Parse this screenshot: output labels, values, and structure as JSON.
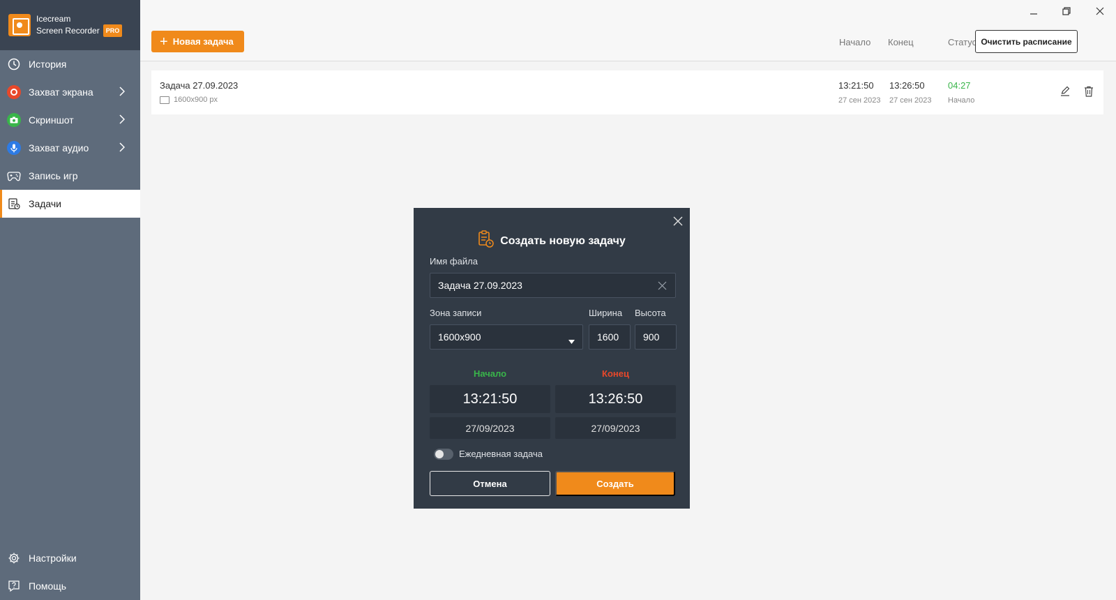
{
  "app": {
    "brand_line1": "Icecream",
    "brand_line2": "Screen Recorder",
    "badge": "PRO",
    "accent_color": "#f08a1b"
  },
  "sidebar": {
    "items": [
      {
        "label": "История",
        "icon": "clock-icon"
      },
      {
        "label": "Захват экрана",
        "icon": "record-icon",
        "has_submenu": true
      },
      {
        "label": "Скриншот",
        "icon": "camera-icon",
        "has_submenu": true
      },
      {
        "label": "Захват аудио",
        "icon": "microphone-icon",
        "has_submenu": true
      },
      {
        "label": "Запись игр",
        "icon": "gamepad-icon"
      },
      {
        "label": "Задачи",
        "icon": "task-icon",
        "active": true
      }
    ],
    "bottom": [
      {
        "label": "Настройки",
        "icon": "gear-icon"
      },
      {
        "label": "Помощь",
        "icon": "help-icon"
      }
    ]
  },
  "toolbar": {
    "new_task_label": "Новая задача",
    "col_start": "Начало",
    "col_end": "Конец",
    "col_status": "Статус",
    "clear_label": "Очистить расписание"
  },
  "tasks": [
    {
      "name": "Задача 27.09.2023",
      "resolution": "1600x900 px",
      "start_time": "13:21:50",
      "start_date": "27 сен 2023",
      "end_time": "13:26:50",
      "end_date": "27 сен 2023",
      "status_time": "04:27",
      "status_label": "Начало"
    }
  ],
  "dialog": {
    "title": "Создать новую задачу",
    "filename_label": "Имя файла",
    "filename_value": "Задача 27.09.2023",
    "zone_label": "Зона записи",
    "zone_value": "1600x900",
    "width_label": "Ширина",
    "width_value": "1600",
    "height_label": "Высота",
    "height_value": "900",
    "start_label": "Начало",
    "end_label": "Конец",
    "start_time": "13:21:50",
    "end_time": "13:26:50",
    "start_date": "27/09/2023",
    "end_date": "27/09/2023",
    "daily_label": "Ежедневная задача",
    "daily_enabled": false,
    "cancel_label": "Отмена",
    "create_label": "Создать",
    "start_color": "#39b54a",
    "end_color": "#e8482a"
  }
}
